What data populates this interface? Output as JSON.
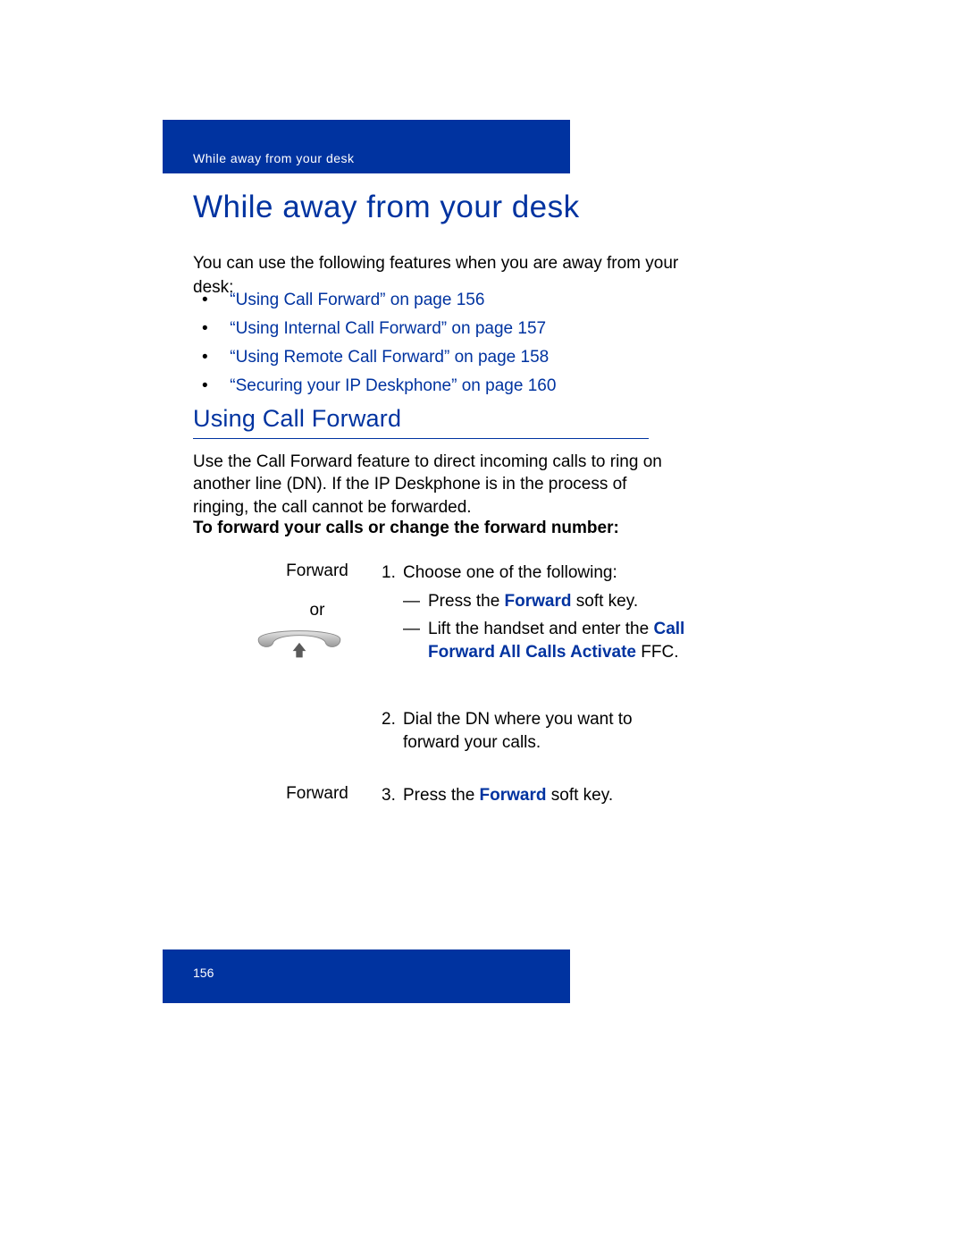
{
  "header": {
    "breadcrumb": "While away from your desk"
  },
  "title": "While away from your desk",
  "intro": "You can use the following features when you are away from your desk:",
  "links": [
    "“Using Call Forward” on page 156",
    "“Using Internal Call Forward” on page 157",
    "“Using Remote Call Forward” on page 158",
    "“Securing your IP Deskphone” on page 160"
  ],
  "section": {
    "title": "Using Call Forward",
    "body": "Use the Call Forward feature to direct incoming calls to ring on another line (DN). If the IP Deskphone is in the process of ringing, the call cannot be forwarded.",
    "procedureTitle": "To forward your calls or change the forward number:"
  },
  "steps": {
    "s1": {
      "left_label": "Forward",
      "left_or": "or",
      "num": "1.",
      "lead": "Choose one of the following:",
      "opt1_pre": "Press the ",
      "opt1_key": "Forward",
      "opt1_post": " soft key.",
      "opt2_pre": "Lift the handset and enter the ",
      "opt2_key": "Call Forward All Calls Activate",
      "opt2_post": " FFC."
    },
    "s2": {
      "num": "2.",
      "text": "Dial the DN where you want to forward your calls."
    },
    "s3": {
      "left_label": "Forward",
      "num": "3.",
      "pre": "Press the ",
      "key": "Forward",
      "post": " soft key."
    }
  },
  "footer": {
    "page": "156"
  }
}
